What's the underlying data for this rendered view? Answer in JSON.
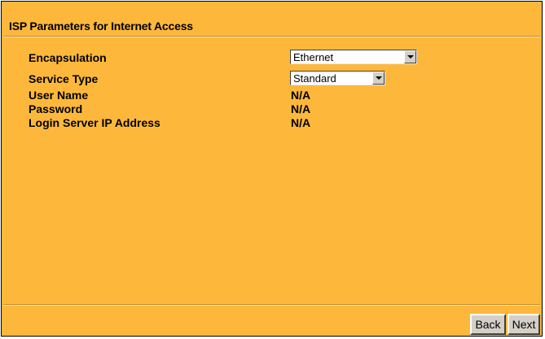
{
  "page": {
    "title": "ISP Parameters for Internet Access"
  },
  "fields": {
    "encapsulation": {
      "label": "Encapsulation",
      "selected": "Ethernet"
    },
    "service_type": {
      "label": "Service Type",
      "selected": "Standard"
    },
    "user_name": {
      "label": "User Name",
      "value": "N/A"
    },
    "password": {
      "label": "Password",
      "value": "N/A"
    },
    "login_server_ip": {
      "label": "Login Server IP Address",
      "value": "N/A"
    }
  },
  "buttons": {
    "back": "Back",
    "next": "Next"
  },
  "colors": {
    "background": "#fdb83c",
    "border": "#000000"
  },
  "icons": {
    "dropdown": "chevron-down-icon"
  }
}
